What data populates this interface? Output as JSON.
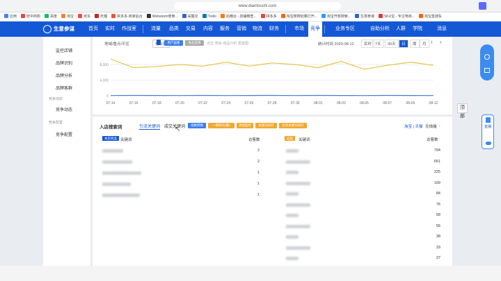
{
  "browser": {
    "url": "www.diantoushi.com",
    "bookmarks": [
      "应用",
      "宏中商购",
      "百度",
      "淘宝",
      "京东",
      "天猫",
      "拼多多·商家后台",
      "Webstorm使用...",
      "采集论",
      "Trello",
      "后稽台 - 店铺稽查...",
      "拼多多",
      "淘宝搜搜批量打开...",
      "淘宝开放搜索...",
      "生意参谋",
      "SKU宝 - 专注电商...",
      "淘宝直通车"
    ]
  },
  "nav": {
    "brand": "生意参谋",
    "items": [
      "首页",
      "实时",
      "作战室",
      "流量",
      "品类",
      "交易",
      "内容",
      "服务",
      "营销",
      "物流",
      "财务",
      "市场",
      "竞争",
      "业务专区",
      "自助分析",
      "人群",
      "学院"
    ],
    "messages": "消息"
  },
  "sidebar": {
    "items": [
      "监控店铺",
      "品牌识别",
      "品牌分析",
      "品牌客群"
    ],
    "group1": "竞争动态",
    "item5": "竞争动态",
    "group2": "竞争配置",
    "item6": "竞争配置"
  },
  "chart_controls": {
    "filter": "地域/重点/平区",
    "device": "作业保",
    "tab_a": "用户画像",
    "tab_b": "商品选择",
    "hint": "点击·竞争·商品分析·重置图",
    "date_label": "统计时间 2020-08-12",
    "periods": [
      "实时",
      "7天",
      "30天",
      "日",
      "周",
      "月"
    ],
    "active_period": "日"
  },
  "chart_data": {
    "type": "line",
    "x": [
      "07-14",
      "07-16",
      "07-18",
      "07-20",
      "07-22",
      "07-24",
      "07-26",
      "07-28",
      "07-30",
      "08-01",
      "08-03",
      "08-05",
      "08-07",
      "08-09",
      "08-12"
    ],
    "yticks": [
      "8,000",
      "4,000",
      "0"
    ],
    "series": [
      {
        "values": [
          9400,
          7200,
          7500,
          8000,
          7600,
          8600,
          7600,
          8400,
          8000,
          7200,
          8800,
          6800,
          7800,
          8600,
          7800
        ],
        "color": "#e8c34a"
      },
      {
        "values": [
          50,
          80,
          70,
          60,
          80,
          60,
          70,
          80,
          60,
          80,
          70,
          60,
          80,
          70,
          60
        ],
        "color": "#4a78d8"
      }
    ]
  },
  "section": {
    "title": "入店搜索词",
    "tabs": [
      "引流关键词",
      "成交关键词"
    ],
    "buttons": [
      "指数转换",
      "一键转化(数)",
      "添加监控",
      "关键词排行",
      "竞店关键词排行"
    ],
    "platform": "淘宝 | 天猫",
    "device": "无线端"
  },
  "left_table": {
    "badge": "本店商品",
    "col_kw": "关键词",
    "col_cnt": "访客数",
    "counts": [
      "2",
      "2",
      "1",
      "1",
      "1"
    ]
  },
  "right_table": {
    "badge": "竞品",
    "col_kw": "关键词",
    "col_cnt": "访客数",
    "counts": [
      "794",
      "651",
      "225",
      "109",
      "84",
      "76",
      "58",
      "56",
      "38",
      "33",
      "27"
    ]
  },
  "float": {
    "up": "顶部",
    "live": "直播"
  }
}
